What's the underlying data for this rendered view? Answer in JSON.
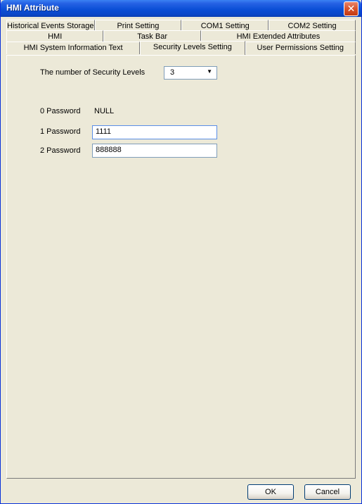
{
  "window": {
    "title": "HMI Attribute",
    "close_glyph": "✕"
  },
  "tabs": {
    "row1": [
      "Historical Events Storage",
      "Print Setting",
      "COM1 Setting",
      "COM2 Setting"
    ],
    "row2": [
      "HMI",
      "Task Bar",
      "HMI Extended Attributes"
    ],
    "row3": [
      "HMI System Information Text",
      "Security Levels Setting",
      "User Permissions Setting"
    ],
    "active": "Security Levels Setting"
  },
  "security": {
    "levels_label": "The number of Security Levels",
    "levels_value": "3",
    "password0_label": "0 Password",
    "password0_value": "NULL",
    "password1_label": "1 Password",
    "password1_value": "1111",
    "password2_label": "2 Password",
    "password2_value": "888888"
  },
  "buttons": {
    "ok": "OK",
    "cancel": "Cancel"
  },
  "icons": {
    "close": "close-icon",
    "dropdown": "chevron-down-icon"
  }
}
